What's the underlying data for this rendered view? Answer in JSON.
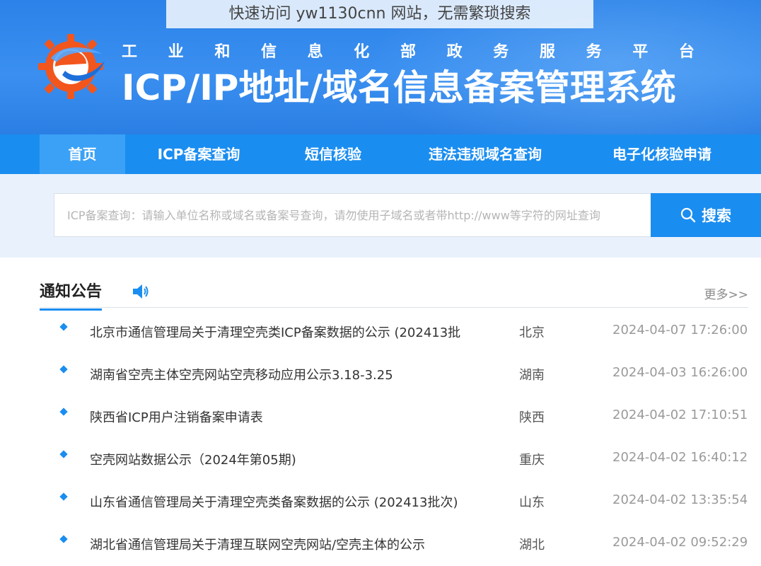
{
  "overlay_caption": "快速访问 yw1130cnn 网站，无需繁琐搜索",
  "header": {
    "ministry_chars": [
      "工",
      "业",
      "和",
      "信",
      "息",
      "化",
      "部",
      "政",
      "务",
      "服",
      "务",
      "平",
      "台"
    ],
    "system_title": "ICP/IP地址/域名信息备案管理系统",
    "logo_icon": "gear-e-logo-icon",
    "colors": {
      "banner": "#2c82e8",
      "nav": "#1a8df0",
      "nav_active": "#3aa1f6",
      "search_bg": "#e8f1fc"
    }
  },
  "nav": {
    "items": [
      {
        "label": "首页",
        "active": true
      },
      {
        "label": "ICP备案查询",
        "active": false
      },
      {
        "label": "短信核验",
        "active": false
      },
      {
        "label": "违法违规域名查询",
        "active": false
      },
      {
        "label": "电子化核验申请",
        "active": false
      }
    ]
  },
  "search": {
    "placeholder": "ICP备案查询：请输入单位名称或域名或备案号查询，请勿使用子域名或者带http://www等字符的网址查询",
    "button_label": "搜索",
    "button_icon": "search-icon"
  },
  "notices": {
    "title": "通知公告",
    "speaker_icon": "speaker-icon",
    "more_label": "更多>>",
    "items": [
      {
        "title": "北京市通信管理局关于清理空壳类ICP备案数据的公示 (202413批",
        "region": "北京",
        "date": "2024-04-07 17:26:00"
      },
      {
        "title": "湖南省空壳主体空壳网站空壳移动应用公示3.18-3.25",
        "region": "湖南",
        "date": "2024-04-03 16:26:00"
      },
      {
        "title": "陕西省ICP用户注销备案申请表",
        "region": "陕西",
        "date": "2024-04-02 17:10:51"
      },
      {
        "title": "空壳网站数据公示（2024年第05期)",
        "region": "重庆",
        "date": "2024-04-02 16:40:12"
      },
      {
        "title": "山东省通信管理局关于清理空壳类备案数据的公示 (202413批次)",
        "region": "山东",
        "date": "2024-04-02 13:35:54"
      },
      {
        "title": "湖北省通信管理局关于清理互联网空壳网站/空壳主体的公示",
        "region": "湖北",
        "date": "2024-04-02 09:52:29"
      }
    ]
  }
}
